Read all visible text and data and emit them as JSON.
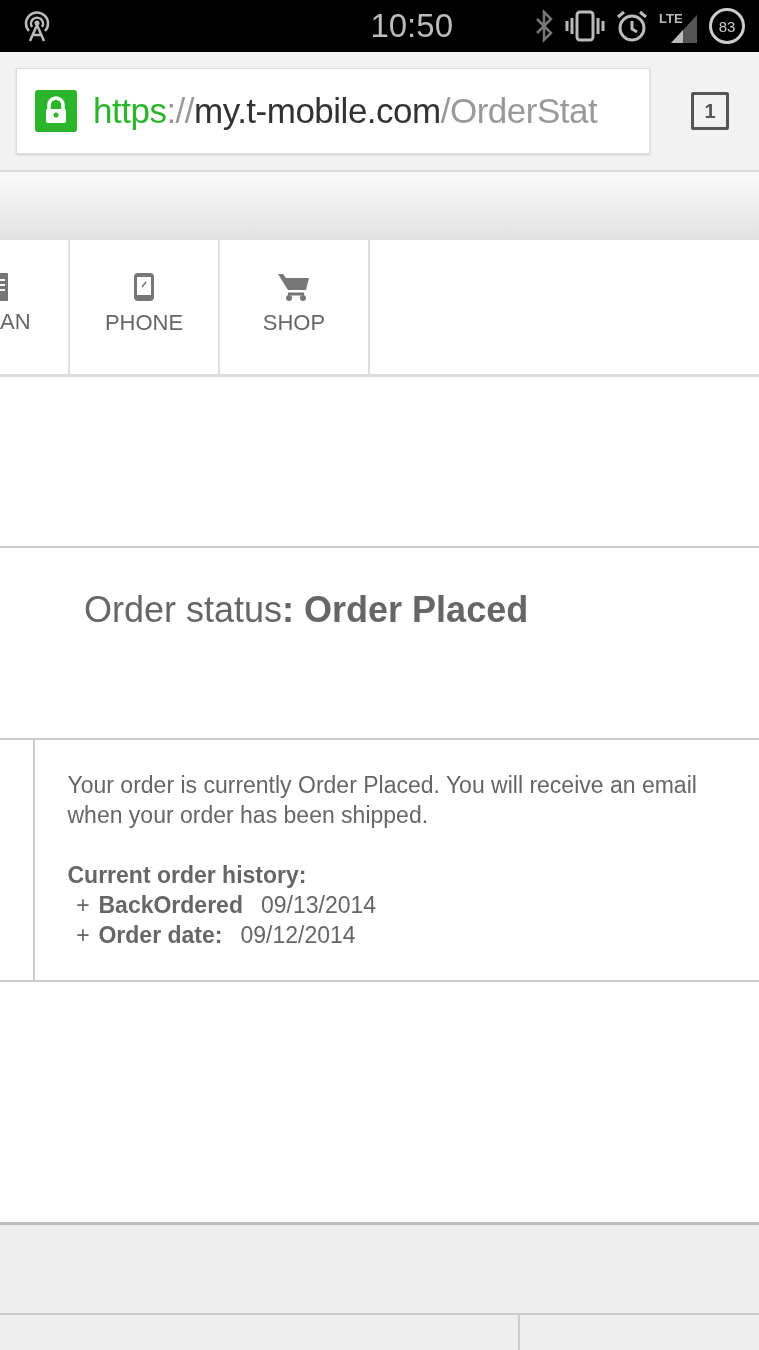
{
  "status_bar": {
    "time": "10:50",
    "network": "LTE",
    "battery": "83"
  },
  "browser": {
    "url_scheme": "https",
    "url_sep": "://",
    "url_host": "my.t-mobile.com",
    "url_path": "/OrderStat",
    "tab_count": "1"
  },
  "nav": [
    {
      "label": "AN",
      "kind": "plan",
      "selected": false
    },
    {
      "label": "PHONE",
      "kind": "phone",
      "selected": false
    },
    {
      "label": "SHOP",
      "kind": "shop",
      "selected": false
    }
  ],
  "order_status": "Order status**: Order Placed**",
  "message": "Your order is currently Order Placed. You will receive an email when your order has been shipped.",
  "history_title": "Current order history:",
  "history": [
    {
      "bullet": "+",
      "label": "BackOrdered",
      "date": "09/13/2014"
    },
    {
      "bullet": "+",
      "label": "Order date:",
      "date": "09/12/2014"
    }
  ]
}
